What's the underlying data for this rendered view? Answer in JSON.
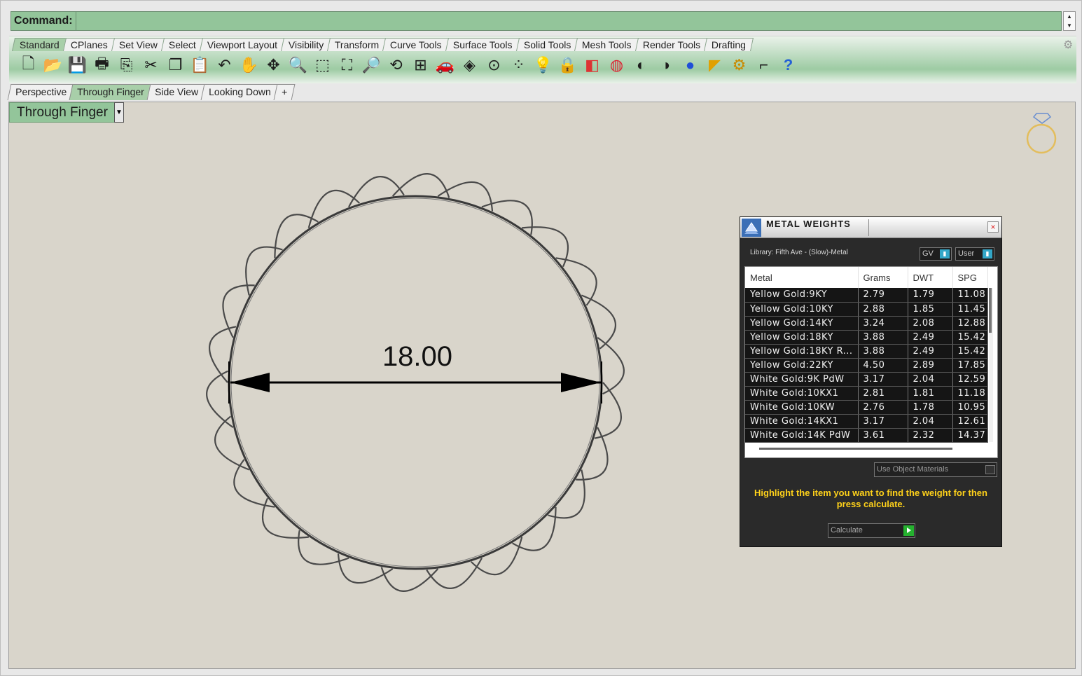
{
  "command": {
    "label": "Command:",
    "value": ""
  },
  "toolbar": {
    "tabs": [
      "Standard",
      "CPlanes",
      "Set View",
      "Select",
      "Viewport Layout",
      "Visibility",
      "Transform",
      "Curve Tools",
      "Surface Tools",
      "Solid Tools",
      "Mesh Tools",
      "Render Tools",
      "Drafting"
    ],
    "active_tab": "Standard",
    "icons": [
      "new-file-icon",
      "open-folder-icon",
      "save-icon",
      "print-icon",
      "import-icon",
      "cut-icon",
      "copy-icon",
      "paste-icon",
      "undo-icon",
      "pan-hand-icon",
      "move-view-icon",
      "zoom-icon",
      "zoom-window-icon",
      "zoom-extents-icon",
      "zoom-selected-icon",
      "rotate-view-icon",
      "four-viewports-icon",
      "car-icon",
      "object-properties-icon",
      "circle-center-icon",
      "points-icon",
      "lightbulb-icon",
      "lock-icon",
      "layer-icon",
      "color-wheel-icon",
      "sphere-gray-icon",
      "sphere-shaded-icon",
      "sphere-blue-icon",
      "render-icon",
      "gear-icon",
      "dimension-icon",
      "help-icon"
    ]
  },
  "viewport_tabs": [
    "Perspective",
    "Through Finger",
    "Side View",
    "Looking Down",
    "+"
  ],
  "active_viewport_tab": "Through Finger",
  "viewport": {
    "title": "Through Finger",
    "dimension": "18.00"
  },
  "panel": {
    "title": "METAL WEIGHTS",
    "close": "×",
    "library": "Library: Fifth Ave - (Slow)-Metal",
    "gv_label": "GV",
    "user_label": "User",
    "columns": [
      "Metal",
      "Grams",
      "DWT",
      "SPG"
    ],
    "rows": [
      [
        "Yellow Gold:9KY",
        "2.79",
        "1.79",
        "11.08"
      ],
      [
        "Yellow Gold:10KY",
        "2.88",
        "1.85",
        "11.45"
      ],
      [
        "Yellow Gold:14KY",
        "3.24",
        "2.08",
        "12.88"
      ],
      [
        "Yellow Gold:18KY",
        "3.88",
        "2.49",
        "15.42"
      ],
      [
        "Yellow Gold:18KY R...",
        "3.88",
        "2.49",
        "15.42"
      ],
      [
        "Yellow Gold:22KY",
        "4.50",
        "2.89",
        "17.85"
      ],
      [
        "White Gold:9K PdW",
        "3.17",
        "2.04",
        "12.59"
      ],
      [
        "White Gold:10KX1",
        "2.81",
        "1.81",
        "11.18"
      ],
      [
        "White Gold:10KW",
        "2.76",
        "1.78",
        "10.95"
      ],
      [
        "White Gold:14KX1",
        "3.17",
        "2.04",
        "12.61"
      ],
      [
        "White Gold:14K PdW",
        "3.61",
        "2.32",
        "14.37"
      ]
    ],
    "use_object_materials": "Use Object Materials",
    "hint": "Highlight the item you want to find the weight for then press calculate.",
    "calculate": "Calculate"
  }
}
